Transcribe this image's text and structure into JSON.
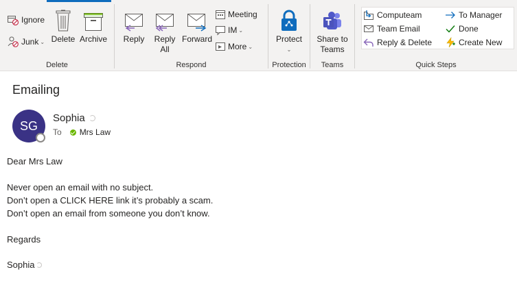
{
  "ribbon": {
    "delete_group": {
      "label": "Delete",
      "ignore": "Ignore",
      "junk": "Junk",
      "delete": "Delete",
      "archive": "Archive"
    },
    "respond_group": {
      "label": "Respond",
      "reply": "Reply",
      "reply_all_1": "Reply",
      "reply_all_2": "All",
      "forward": "Forward",
      "meeting": "Meeting",
      "im": "IM",
      "more": "More"
    },
    "protection_group": {
      "label": "Protection",
      "protect": "Protect"
    },
    "teams_group": {
      "label": "Teams",
      "share_1": "Share to",
      "share_2": "Teams"
    },
    "quick_steps_group": {
      "label": "Quick Steps",
      "items": [
        {
          "label": "Computeam",
          "icon": "folder-arrow-icon"
        },
        {
          "label": "Team Email",
          "icon": "envelope-icon"
        },
        {
          "label": "Reply & Delete",
          "icon": "reply-icon"
        },
        {
          "label": "To Manager",
          "icon": "arrow-right-icon"
        },
        {
          "label": "Done",
          "icon": "check-icon"
        },
        {
          "label": "Create New",
          "icon": "lightning-icon"
        }
      ]
    }
  },
  "message": {
    "subject": "Emailing",
    "avatar_initials": "SG",
    "sender": "Sophia",
    "to_label": "To",
    "recipient": "Mrs Law",
    "body": {
      "greeting": "Dear Mrs Law",
      "line1": "Never open an email with no subject.",
      "line2": "Don’t open a CLICK HERE link it’s probably a scam.",
      "line3": "Don’t open an email from someone you don’t know.",
      "closing": "Regards",
      "signature": "Sophia"
    }
  },
  "colors": {
    "ribbon_bg": "#f3f2f1",
    "avatar_bg": "#3a3285",
    "accent_blue": "#0f6cbd",
    "presence_green": "#6bb700"
  }
}
